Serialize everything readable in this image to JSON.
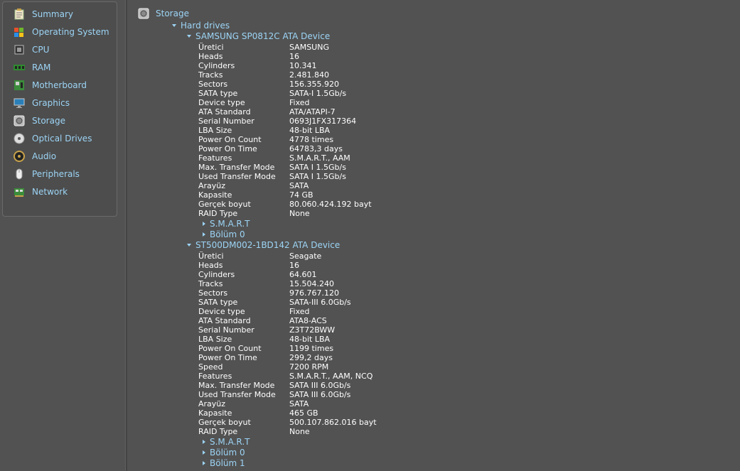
{
  "sidebar": {
    "items": [
      {
        "label": "Summary",
        "icon": "summary-icon"
      },
      {
        "label": "Operating System",
        "icon": "windows-icon"
      },
      {
        "label": "CPU",
        "icon": "cpu-icon"
      },
      {
        "label": "RAM",
        "icon": "ram-icon"
      },
      {
        "label": "Motherboard",
        "icon": "motherboard-icon"
      },
      {
        "label": "Graphics",
        "icon": "monitor-icon"
      },
      {
        "label": "Storage",
        "icon": "hard-drive-icon"
      },
      {
        "label": "Optical Drives",
        "icon": "disc-icon"
      },
      {
        "label": "Audio",
        "icon": "speaker-icon"
      },
      {
        "label": "Peripherals",
        "icon": "mouse-icon"
      },
      {
        "label": "Network",
        "icon": "network-icon"
      }
    ]
  },
  "content": {
    "title": "Storage",
    "hard_drives_label": "Hard drives",
    "drives": [
      {
        "name": "SAMSUNG SP0812C ATA Device",
        "properties": [
          [
            "Üretici",
            "SAMSUNG"
          ],
          [
            "Heads",
            "16"
          ],
          [
            "Cylinders",
            "10.341"
          ],
          [
            "Tracks",
            "2.481.840"
          ],
          [
            "Sectors",
            "156.355.920"
          ],
          [
            "SATA type",
            "SATA-I 1.5Gb/s"
          ],
          [
            "Device type",
            "Fixed"
          ],
          [
            "ATA Standard",
            "ATA/ATAPI-7"
          ],
          [
            "Serial Number",
            "0693J1FX317364"
          ],
          [
            "LBA Size",
            "48-bit LBA"
          ],
          [
            "Power On Count",
            "4778 times"
          ],
          [
            "Power On Time",
            "64783,3 days"
          ],
          [
            "Features",
            "S.M.A.R.T., AAM"
          ],
          [
            "Max. Transfer Mode",
            "SATA I 1.5Gb/s"
          ],
          [
            "Used Transfer Mode",
            "SATA I 1.5Gb/s"
          ],
          [
            "Arayüz",
            "SATA"
          ],
          [
            "Kapasite",
            "74 GB"
          ],
          [
            "Gerçek boyut",
            "80.060.424.192 bayt"
          ],
          [
            "RAID Type",
            "None"
          ]
        ],
        "children": [
          "S.M.A.R.T",
          "Bölüm 0"
        ]
      },
      {
        "name": "ST500DM002-1BD142 ATA Device",
        "properties": [
          [
            "Üretici",
            "Seagate"
          ],
          [
            "Heads",
            "16"
          ],
          [
            "Cylinders",
            "64.601"
          ],
          [
            "Tracks",
            "15.504.240"
          ],
          [
            "Sectors",
            "976.767.120"
          ],
          [
            "SATA type",
            "SATA-III 6.0Gb/s"
          ],
          [
            "Device type",
            "Fixed"
          ],
          [
            "ATA Standard",
            "ATA8-ACS"
          ],
          [
            "Serial Number",
            "Z3T72BWW"
          ],
          [
            "LBA Size",
            "48-bit LBA"
          ],
          [
            "Power On Count",
            "1199 times"
          ],
          [
            "Power On Time",
            "299,2 days"
          ],
          [
            "Speed",
            "7200 RPM"
          ],
          [
            "Features",
            "S.M.A.R.T., AAM, NCQ"
          ],
          [
            "Max. Transfer Mode",
            "SATA III 6.0Gb/s"
          ],
          [
            "Used Transfer Mode",
            "SATA III 6.0Gb/s"
          ],
          [
            "Arayüz",
            "SATA"
          ],
          [
            "Kapasite",
            "465 GB"
          ],
          [
            "Gerçek boyut",
            "500.107.862.016 bayt"
          ],
          [
            "RAID Type",
            "None"
          ]
        ],
        "children": [
          "S.M.A.R.T",
          "Bölüm 0",
          "Bölüm 1"
        ]
      }
    ]
  }
}
